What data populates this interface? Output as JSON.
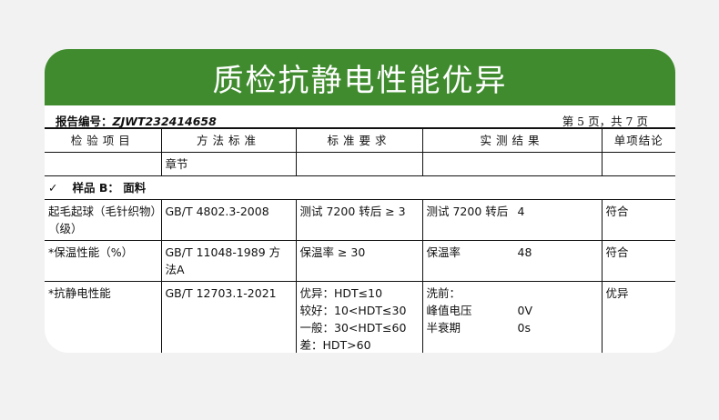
{
  "banner": {
    "title": "质检抗静电性能优异"
  },
  "report": {
    "number_label": "报告编号：",
    "number_value": "ZJWT232414658",
    "page_info": "第 5 页，共 7 页"
  },
  "table": {
    "headers": [
      "检验项目",
      "方法标准",
      "标准要求",
      "实测结果",
      "单项结论"
    ],
    "blank_row": {
      "method": "章节"
    },
    "section": {
      "check": "✓",
      "label": "样品 B：  面料"
    },
    "rows": [
      {
        "item": "起毛起球（毛针织物）（级）",
        "method": "GB/T 4802.3-2008",
        "requirement": "测试 7200 转后 ≥ 3",
        "result_label": "测试 7200 转后",
        "result_value": "4",
        "conclusion": "符合"
      },
      {
        "item": "*保温性能（%）",
        "method": "GB/T 11048-1989 方法A",
        "requirement": "保温率 ≥ 30",
        "result_label": "保温率",
        "result_value": "48",
        "conclusion": "符合"
      },
      {
        "item": "*抗静电性能",
        "method": "GB/T 12703.1-2021",
        "requirement_lines": [
          "优异：HDT≤10",
          "较好：10<HDT≤30",
          "一般：30<HDT≤60",
          "差：HDT>60"
        ],
        "result_title": "洗前：",
        "result_pairs": [
          {
            "label": "峰值电压",
            "value": "0V"
          },
          {
            "label": "半衰期",
            "value": "0s"
          }
        ],
        "conclusion": "优异"
      }
    ]
  },
  "colors": {
    "banner": "#3f8b2e",
    "background": "#f2f2f2"
  }
}
